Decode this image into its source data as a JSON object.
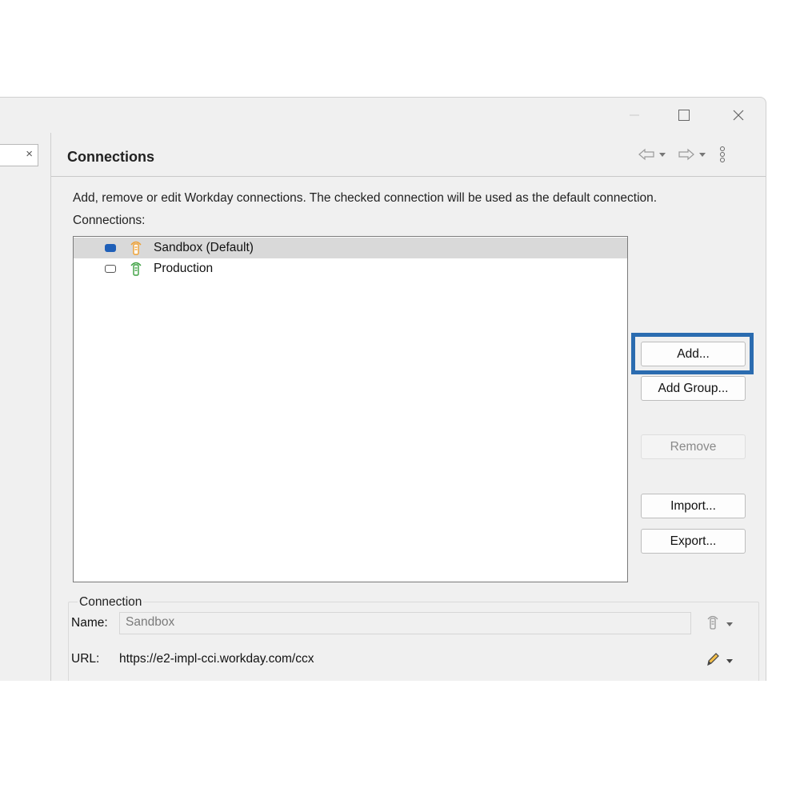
{
  "window": {
    "controls": {
      "minimize": "minimize-icon",
      "maximize": "maximize-icon",
      "close": "close-icon"
    }
  },
  "left_pane": {
    "filter_clear": "×"
  },
  "header": {
    "title": "Connections",
    "icons": [
      "back-arrow-icon",
      "dropdown-icon",
      "forward-arrow-icon",
      "dropdown-icon",
      "more-icon"
    ]
  },
  "description": "Add, remove or edit Workday connections. The checked connection will be used as the default connection.",
  "connections_label": "Connections:",
  "connections": [
    {
      "label": "Sandbox (Default)",
      "checked": true,
      "selected": true,
      "icon": "connection-orange-icon"
    },
    {
      "label": "Production",
      "checked": false,
      "selected": false,
      "icon": "connection-green-icon"
    }
  ],
  "buttons": {
    "add": "Add...",
    "add_group": "Add Group...",
    "remove": "Remove",
    "import": "Import...",
    "export": "Export..."
  },
  "connection_group": {
    "legend": "Connection",
    "name_label": "Name:",
    "name_value": "Sandbox",
    "url_label": "URL:",
    "url_value": "https://e2-impl-cci.workday.com/ccx"
  },
  "colors": {
    "accent": "#2b6cb0",
    "checkbox_checked": "#1f5fb8",
    "icon_orange": "#f0a030",
    "icon_green": "#3ca040"
  }
}
